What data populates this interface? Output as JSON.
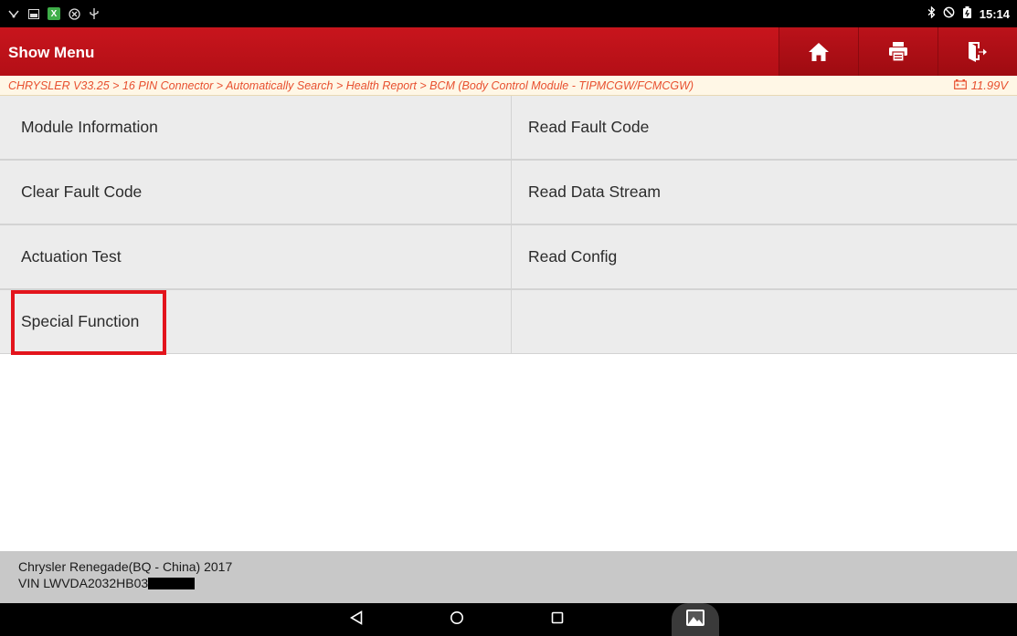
{
  "status_bar": {
    "left_icons": [
      "usb-debug-icon",
      "screenshot-icon",
      "x-app-icon",
      "blocked-icon",
      "usb-icon"
    ],
    "right_icons": [
      "bluetooth-icon",
      "alarm-off-icon",
      "battery-icon"
    ],
    "time": "15:14"
  },
  "header": {
    "title": "Show Menu",
    "buttons": [
      "home-icon",
      "print-icon",
      "exit-icon"
    ],
    "accent_color": "#c8151d"
  },
  "breadcrumb": {
    "path": "CHRYSLER V33.25 > 16 PIN Connector > Automatically Search > Health Report > BCM (Body Control Module - TIPMCGW/FCMCGW)",
    "voltage": "11.99V"
  },
  "menu": {
    "items": [
      "Module Information",
      "Read Fault Code",
      "Clear Fault Code",
      "Read Data Stream",
      "Actuation Test",
      "Read Config",
      "Special Function",
      ""
    ]
  },
  "vehicle": {
    "model": "Chrysler Renegade(BQ - China) 2017",
    "vin": "VIN LWVDA2032HB03"
  },
  "nav_bar": {
    "buttons": [
      "back-icon",
      "home-circle-icon",
      "recents-icon",
      "gallery-icon"
    ]
  }
}
